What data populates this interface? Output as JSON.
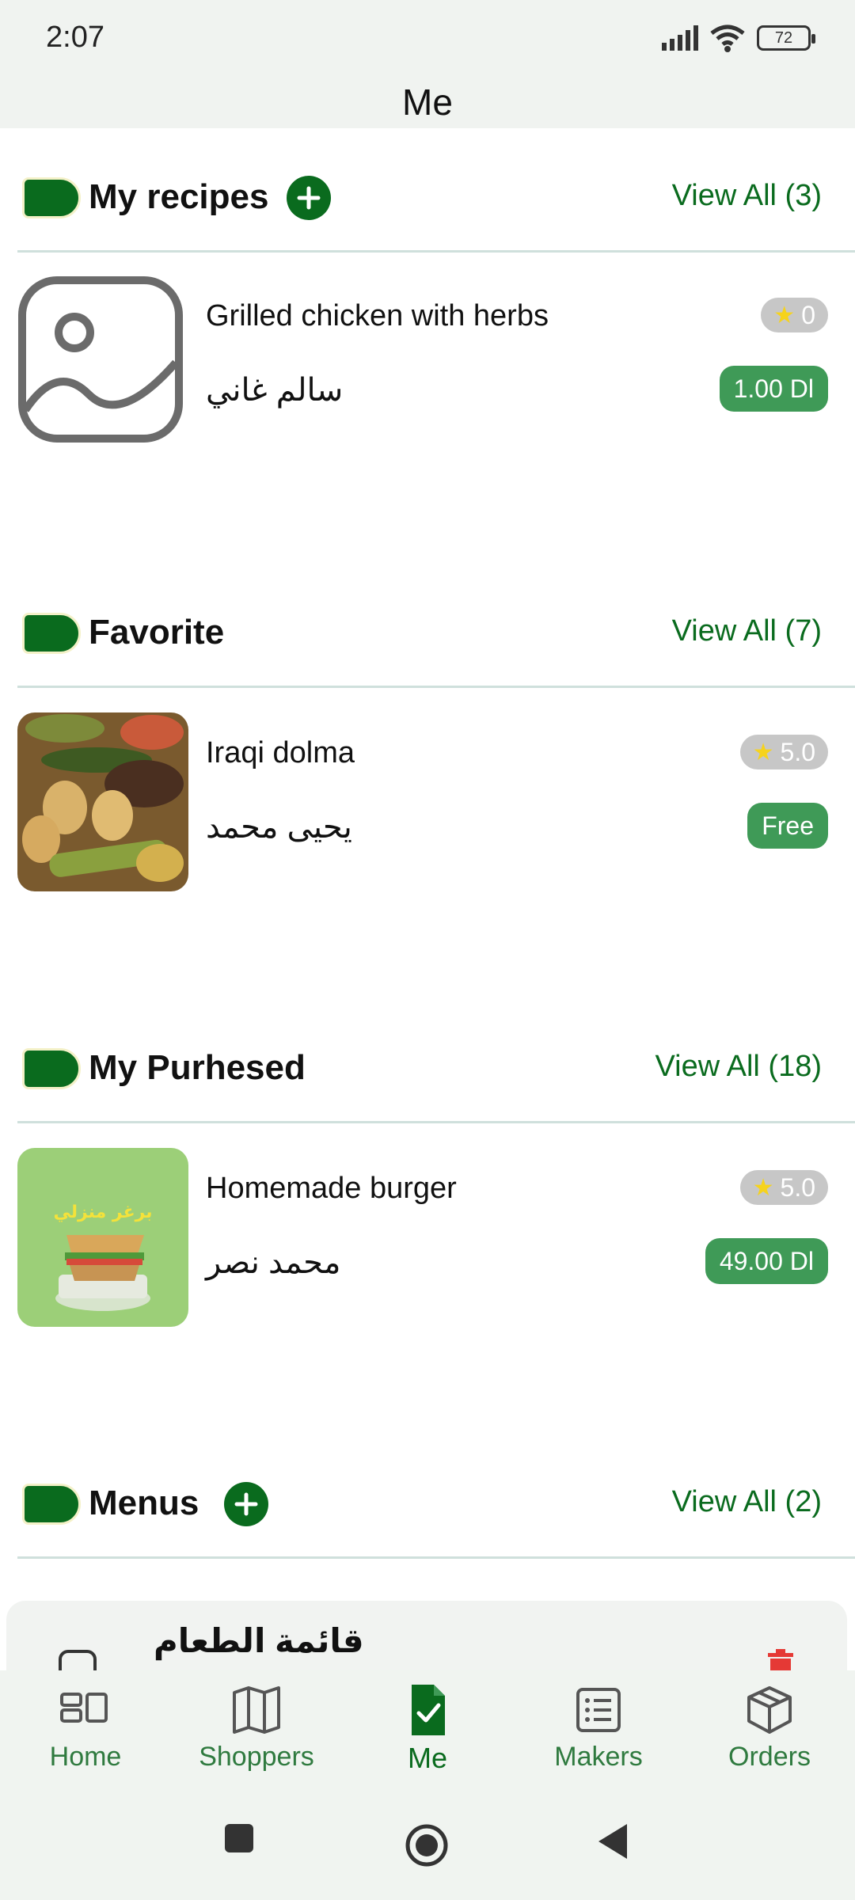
{
  "status": {
    "time": "2:07",
    "battery": "72"
  },
  "appbar": {
    "title": "Me"
  },
  "sections": {
    "recipes": {
      "title": "My recipes",
      "view_all": "View All (3)",
      "item": {
        "title": "Grilled chicken with herbs",
        "author": "سالم غاني",
        "rating": "0",
        "price": "1.00 Dl"
      }
    },
    "favorite": {
      "title": "Favorite",
      "view_all": "View All (7)",
      "item": {
        "title": "Iraqi dolma",
        "author": "يحيى محمد",
        "rating": "5.0",
        "price": "Free"
      }
    },
    "purchased": {
      "title": "My Purhesed",
      "view_all": "View All (18)",
      "item": {
        "title": "Homemade burger",
        "author": "محمد نصر",
        "rating": "5.0",
        "price": "49.00 Dl",
        "image_text": "برغر منزلي"
      }
    },
    "menus": {
      "title": "Menus",
      "view_all": "View All (2)",
      "item": {
        "title": "قائمة الطعام"
      }
    }
  },
  "bottom_nav": {
    "items": [
      {
        "label": "Home",
        "icon": "home-layout-icon"
      },
      {
        "label": "Shoppers",
        "icon": "map-icon"
      },
      {
        "label": "Me",
        "icon": "document-check-icon",
        "active": true
      },
      {
        "label": "Makers",
        "icon": "list-icon"
      },
      {
        "label": "Orders",
        "icon": "box-icon"
      }
    ]
  },
  "colors": {
    "brand": "#0a6b1e",
    "price_bg": "#3f9a57",
    "rating_bg": "#c7c7c7",
    "star": "#f6d31c",
    "delete": "#e53935"
  }
}
